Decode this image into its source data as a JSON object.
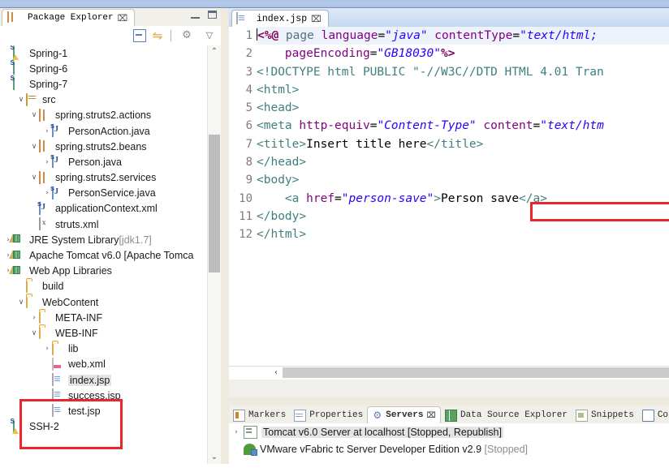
{
  "explorer": {
    "tab_label": "Package Explorer",
    "close_glyph": "⌧",
    "toolbar": {
      "collapse_all": "collapse-all",
      "link_with_editor": "link-with-editor",
      "focus": "focus-on-active-task",
      "view_menu": "▽"
    },
    "window_controls": {
      "minimize": "minimize",
      "maximize": "maximize"
    },
    "tree": [
      {
        "label": "Spring-1",
        "icon": "project-warning",
        "indent": 0,
        "twist": ""
      },
      {
        "label": "Spring-6",
        "icon": "project",
        "indent": 0,
        "twist": ""
      },
      {
        "label": "Spring-7",
        "icon": "project",
        "indent": 0,
        "twist": ""
      },
      {
        "label": "src",
        "icon": "source-folder",
        "indent": 1,
        "twist": "∨"
      },
      {
        "label": "spring.struts2.actions",
        "icon": "package",
        "indent": 2,
        "twist": "∨"
      },
      {
        "label": "PersonAction.java",
        "icon": "java-file",
        "indent": 3,
        "twist": "›"
      },
      {
        "label": "spring.struts2.beans",
        "icon": "package",
        "indent": 2,
        "twist": "∨"
      },
      {
        "label": "Person.java",
        "icon": "java-file",
        "indent": 3,
        "twist": "›"
      },
      {
        "label": "spring.struts2.services",
        "icon": "package",
        "indent": 2,
        "twist": "∨"
      },
      {
        "label": "PersonService.java",
        "icon": "java-file",
        "indent": 3,
        "twist": "›"
      },
      {
        "label": "applicationContext.xml",
        "icon": "xml-bean-file",
        "indent": 2,
        "twist": ""
      },
      {
        "label": "struts.xml",
        "icon": "xml-file",
        "indent": 2,
        "twist": ""
      },
      {
        "label": "JRE System Library",
        "suffix": " [jdk1.7]",
        "icon": "library",
        "indent": 0,
        "twist": "›"
      },
      {
        "label": "Apache Tomcat v6.0 [Apache Tomca",
        "icon": "library",
        "indent": 0,
        "twist": "›"
      },
      {
        "label": "Web App Libraries",
        "icon": "library",
        "indent": 0,
        "twist": "›"
      },
      {
        "label": "build",
        "icon": "folder",
        "indent": 1,
        "twist": ""
      },
      {
        "label": "WebContent",
        "icon": "folder",
        "indent": 1,
        "twist": "∨"
      },
      {
        "label": "META-INF",
        "icon": "folder",
        "indent": 2,
        "twist": "›"
      },
      {
        "label": "WEB-INF",
        "icon": "folder",
        "indent": 2,
        "twist": "∨"
      },
      {
        "label": "lib",
        "icon": "folder",
        "indent": 3,
        "twist": "›"
      },
      {
        "label": "web.xml",
        "icon": "xml-web-file",
        "indent": 3,
        "twist": ""
      },
      {
        "label": "index.jsp",
        "icon": "jsp-file",
        "indent": 3,
        "twist": "",
        "selected": true
      },
      {
        "label": "success.jsp",
        "icon": "jsp-file",
        "indent": 3,
        "twist": ""
      },
      {
        "label": "test.jsp",
        "icon": "jsp-file",
        "indent": 3,
        "twist": ""
      },
      {
        "label": "SSH-2",
        "icon": "project-warning",
        "indent": 0,
        "twist": ""
      }
    ],
    "scrollbar": {
      "up": "⌃",
      "down": "⌄"
    }
  },
  "editor": {
    "tab_label": "index.jsp",
    "close_glyph": "⌧",
    "line_numbers": [
      "1",
      "2",
      "3",
      "4",
      "5",
      "6",
      "7",
      "8",
      "9",
      "10",
      "11",
      "12"
    ],
    "hscroll_arrow": "‹"
  },
  "bottom_panel": {
    "tabs": [
      {
        "label": "Markers",
        "icon": "markers-icon",
        "active": false
      },
      {
        "label": "Properties",
        "icon": "properties-icon",
        "active": false
      },
      {
        "label": "Servers",
        "icon": "servers-icon",
        "active": true,
        "close_glyph": "⌧"
      },
      {
        "label": "Data Source Explorer",
        "icon": "data-source-explorer-icon",
        "active": false
      },
      {
        "label": "Snippets",
        "icon": "snippets-icon",
        "active": false
      },
      {
        "label": "Console",
        "icon": "console-icon",
        "active": false
      }
    ],
    "servers": [
      {
        "twist": "›",
        "icon": "tomcat-server-icon",
        "name": "Tomcat v6.0 Server at localhost",
        "status": "[Stopped, Republish]",
        "selected": true
      },
      {
        "twist": "",
        "icon": "vmware-server-icon",
        "name": "VMware vFabric tc Server Developer Edition v2.9",
        "status": "[Stopped]",
        "selected": false
      }
    ]
  },
  "highlights": {
    "jsp_files_box_color": "#e8262d",
    "code_line_box_color": "#e8262d"
  },
  "colors": {
    "tag": "#3f7f7f",
    "attribute": "#7f007f",
    "value": "#2a00ff",
    "directive": "#7f0055",
    "selection": "#e4e4e4",
    "tab_gradient_top": "#dfe9f7"
  }
}
